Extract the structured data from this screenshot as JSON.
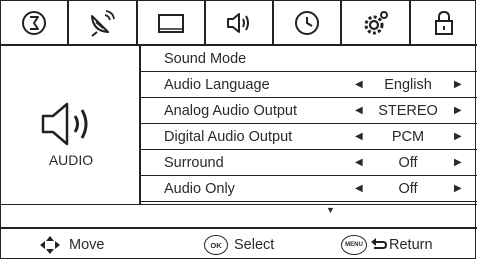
{
  "tabs": [
    {
      "name": "picture",
      "icon": "picture-tab-icon"
    },
    {
      "name": "channel",
      "icon": "satellite-dish-icon"
    },
    {
      "name": "screen",
      "icon": "screen-tab-icon"
    },
    {
      "name": "audio",
      "icon": "speaker-icon",
      "active": true
    },
    {
      "name": "time",
      "icon": "clock-icon"
    },
    {
      "name": "setup",
      "icon": "gear-icon"
    },
    {
      "name": "lock",
      "icon": "lock-icon"
    }
  ],
  "section": {
    "label": "AUDIO",
    "icon": "speaker-large-icon"
  },
  "menu": [
    {
      "label": "Sound Mode",
      "value": "",
      "arrows": false
    },
    {
      "label": "Audio Language",
      "value": "English",
      "arrows": true
    },
    {
      "label": "Analog Audio Output",
      "value": "STEREO",
      "arrows": true
    },
    {
      "label": "Digital Audio Output",
      "value": "PCM",
      "arrows": true
    },
    {
      "label": "Surround",
      "value": "Off",
      "arrows": true
    },
    {
      "label": "Audio Only",
      "value": "Off",
      "arrows": true
    }
  ],
  "footer": {
    "move_label": "Move",
    "select_label": "Select",
    "return_label": "Return",
    "ok_badge": "OK",
    "menu_badge": "MENU"
  }
}
